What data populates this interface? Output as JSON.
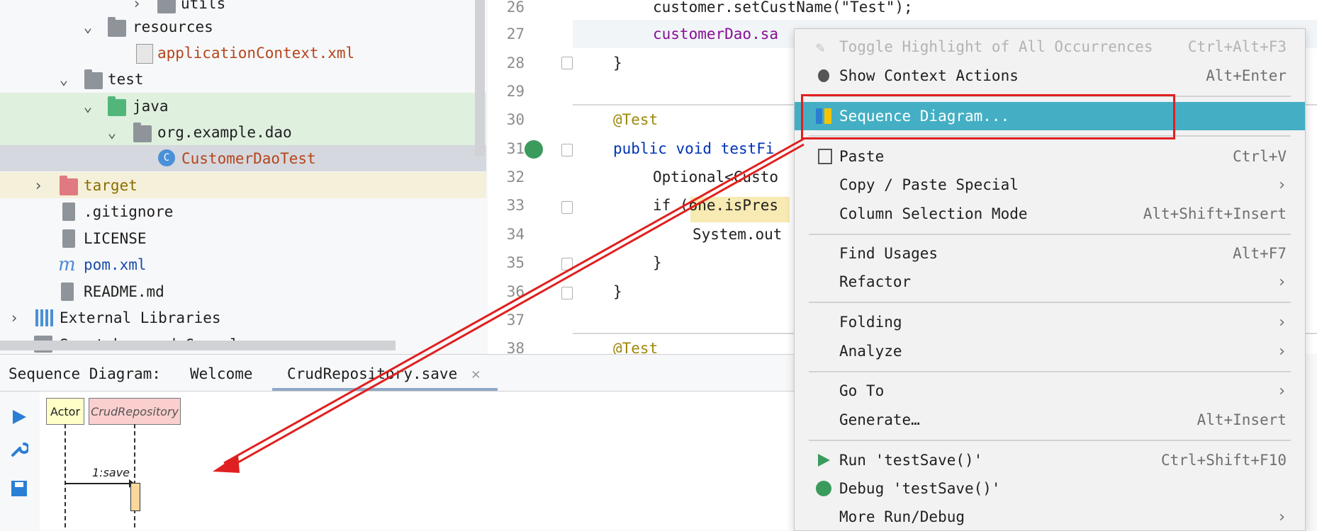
{
  "project_tree": {
    "items": [
      {
        "label": "utils"
      },
      {
        "label": "resources"
      },
      {
        "label": "applicationContext.xml"
      },
      {
        "label": "test"
      },
      {
        "label": "java"
      },
      {
        "label": "org.example.dao"
      },
      {
        "label": "CustomerDaoTest"
      },
      {
        "label": "target"
      },
      {
        "label": ".gitignore"
      },
      {
        "label": "LICENSE"
      },
      {
        "label": "pom.xml"
      },
      {
        "label": "README.md"
      },
      {
        "label": "External Libraries"
      },
      {
        "label": "Scratches and Consoles"
      }
    ],
    "colors": {
      "xml_file": "#b5451b",
      "test_class": "#b5451b",
      "pom": "#1a4ba8"
    }
  },
  "editor": {
    "lines": [
      {
        "num": "26",
        "code": "customer.setCustName(\"Test\");"
      },
      {
        "num": "27",
        "code": "customerDao.sa"
      },
      {
        "num": "28",
        "code": "}"
      },
      {
        "num": "29",
        "code": ""
      },
      {
        "num": "30",
        "code": "@Test"
      },
      {
        "num": "31",
        "code": "public void testFi"
      },
      {
        "num": "32",
        "code": "Optional<Custo"
      },
      {
        "num": "33",
        "code": "if (one.isPres"
      },
      {
        "num": "34",
        "code": "System.out"
      },
      {
        "num": "35",
        "code": "}"
      },
      {
        "num": "36",
        "code": "}"
      },
      {
        "num": "37",
        "code": ""
      },
      {
        "num": "38",
        "code": "@Test"
      }
    ]
  },
  "context_menu": {
    "items": [
      {
        "label": "Toggle Highlight of All Occurrences",
        "shortcut": "Ctrl+Alt+F3"
      },
      {
        "label": "Show Context Actions",
        "shortcut": "Alt+Enter"
      },
      {
        "label": "Sequence Diagram...",
        "shortcut": ""
      },
      {
        "label": "Paste",
        "shortcut": "Ctrl+V"
      },
      {
        "label": "Copy / Paste Special",
        "shortcut": ""
      },
      {
        "label": "Column Selection Mode",
        "shortcut": "Alt+Shift+Insert"
      },
      {
        "label": "Find Usages",
        "shortcut": "Alt+F7"
      },
      {
        "label": "Refactor",
        "shortcut": ""
      },
      {
        "label": "Folding",
        "shortcut": ""
      },
      {
        "label": "Analyze",
        "shortcut": ""
      },
      {
        "label": "Go To",
        "shortcut": ""
      },
      {
        "label": "Generate…",
        "shortcut": "Alt+Insert"
      },
      {
        "label": "Run 'testSave()'",
        "shortcut": "Ctrl+Shift+F10"
      },
      {
        "label": "Debug 'testSave()'",
        "shortcut": ""
      },
      {
        "label": "More Run/Debug",
        "shortcut": ""
      }
    ],
    "highlight_color": "#44afc4"
  },
  "bottom_panel": {
    "title": "Sequence Diagram:",
    "tabs": [
      {
        "label": "Welcome"
      },
      {
        "label": "CrudRepository.save"
      }
    ],
    "diagram": {
      "actor": "Actor",
      "participant": "CrudRepository",
      "message": "1:save"
    }
  },
  "annotation": {
    "color": "#e02020"
  }
}
